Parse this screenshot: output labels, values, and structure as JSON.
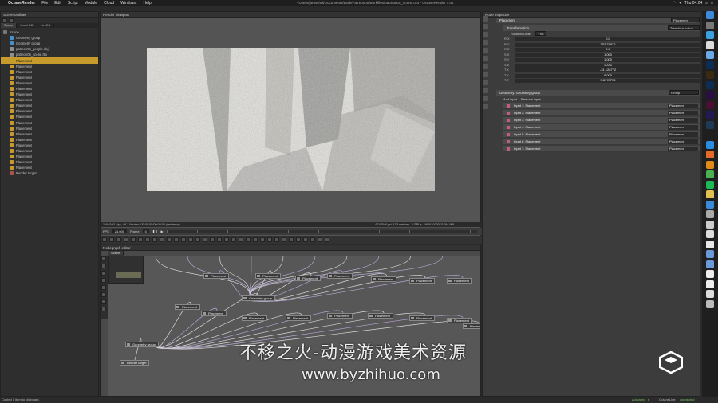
{
  "menubar": {
    "app_name": "OctaneRender",
    "items": [
      "File",
      "Edit",
      "Script",
      "Module",
      "Cloud",
      "Windows",
      "Help"
    ],
    "window_title": "*/Users/jaruschnl/Documents/work/Patreon05/workfiles/patreon05_scene.ocs - OctaneRender 4.04",
    "clock": "Thu 04:04"
  },
  "outliner": {
    "title": "Scene outliner",
    "tabs": [
      "Scene",
      "Local DB",
      "LiveDB"
    ],
    "items": [
      {
        "label": "Scene",
        "type": "root"
      },
      {
        "label": "Geometry group",
        "type": "geometry"
      },
      {
        "label": "Geometry group",
        "type": "geometry"
      },
      {
        "label": "patreon05_people.obj",
        "type": "mesh"
      },
      {
        "label": "patreon05_scene.fbx",
        "type": "mesh"
      },
      {
        "label": "Placement",
        "type": "placement",
        "selected": true
      },
      {
        "label": "Placement",
        "type": "placement"
      },
      {
        "label": "Placement",
        "type": "placement"
      },
      {
        "label": "Placement",
        "type": "placement"
      },
      {
        "label": "Placement",
        "type": "placement"
      },
      {
        "label": "Placement",
        "type": "placement"
      },
      {
        "label": "Placement",
        "type": "placement"
      },
      {
        "label": "Placement",
        "type": "placement"
      },
      {
        "label": "Placement",
        "type": "placement"
      },
      {
        "label": "Placement",
        "type": "placement"
      },
      {
        "label": "Placement",
        "type": "placement"
      },
      {
        "label": "Placement",
        "type": "placement"
      },
      {
        "label": "Placement",
        "type": "placement"
      },
      {
        "label": "Placement",
        "type": "placement"
      },
      {
        "label": "Placement",
        "type": "placement"
      },
      {
        "label": "Placement",
        "type": "placement"
      },
      {
        "label": "Placement",
        "type": "placement"
      },
      {
        "label": "Placement",
        "type": "placement"
      },
      {
        "label": "Placement",
        "type": "placement"
      },
      {
        "label": "Placement",
        "type": "placement"
      },
      {
        "label": "Render target",
        "type": "render"
      }
    ]
  },
  "viewport": {
    "title": "Render viewport",
    "status_left": "1.49/160 s/px, 46.1 Ms/sec, 00:00:05/00:00:01 (rendering...)",
    "status_right": "6747046 pri, 103 meshes, 2 GPUs, 1695/10000/11264 MB",
    "fps_label": "FPS",
    "fps_value": "24.000",
    "frame_label": "Frame",
    "frame_value": "0"
  },
  "nodegraph": {
    "title": "Nodegraph editor",
    "tab": "Scene",
    "nodes": {
      "placement": "Placement",
      "geometry_group": "Geometry group",
      "render_target": "Render target"
    }
  },
  "inspector": {
    "title": "Node inspector",
    "node_name": "Placement",
    "node_type": "Placement",
    "transformation": {
      "label": "Transformation",
      "type": "Transform value",
      "rotation_order_label": "Rotation Order",
      "rotation_order": "YXZ",
      "rows": [
        {
          "label": "R.X",
          "value": "0.0"
        },
        {
          "label": "R.Y",
          "value": "352.33932"
        },
        {
          "label": "R.Z",
          "value": "0.0"
        },
        {
          "label": "S.X",
          "value": "1.000"
        },
        {
          "label": "S.Y",
          "value": "1.000"
        },
        {
          "label": "S.Z",
          "value": "1.000"
        },
        {
          "label": "T.X",
          "value": "-31.128772"
        },
        {
          "label": "T.Y",
          "value": "0.000"
        },
        {
          "label": "T.Z",
          "value": "3.8178735"
        }
      ]
    },
    "geometry": {
      "label": "Geometry: Geometry group",
      "type": "Group",
      "add_input": "Add input",
      "remove_input": "Remove input",
      "inputs": [
        {
          "label": "Input 1: Placement",
          "value": "Placement"
        },
        {
          "label": "Input 2: Placement",
          "value": "Placement"
        },
        {
          "label": "Input 3: Placement",
          "value": "Placement"
        },
        {
          "label": "Input 4: Placement",
          "value": "Placement"
        },
        {
          "label": "Input 5: Placement",
          "value": "Placement"
        },
        {
          "label": "Input 6: Placement",
          "value": "Placement"
        },
        {
          "label": "Input 7: Placement",
          "value": "Placement"
        }
      ]
    }
  },
  "statusbar": {
    "left": "Copied 1 item to clipboard.",
    "activated": "Activated",
    "octanelive": "OctaneLive:",
    "connected": "connected"
  },
  "watermark": {
    "line1": "不移之火-动漫游戏美术资源",
    "line2": "www.byzhihuo.com"
  },
  "colors": {
    "selection": "#c79a2c",
    "input_pin": "#c1607a",
    "render_bg": "#e2e1dc"
  }
}
